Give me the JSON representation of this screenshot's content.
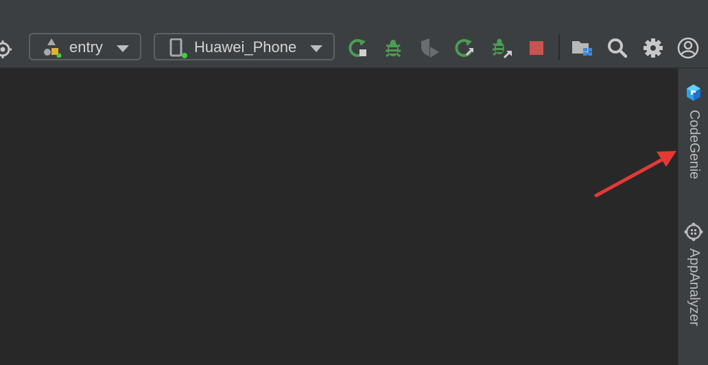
{
  "toolbar": {
    "module_selector": {
      "label": "entry"
    },
    "device_selector": {
      "label": "Huawei_Phone"
    },
    "icons": [
      "target-settings-icon",
      "module-icon",
      "phone-icon",
      "run-icon",
      "debug-icon",
      "profile-icon",
      "apply-changes-icon",
      "attach-debugger-icon",
      "stop-icon",
      "project-structure-icon",
      "search-icon",
      "gear-icon",
      "account-icon"
    ]
  },
  "right_panel": {
    "tabs": [
      {
        "label": "CodeGenie",
        "icon": "codegenie-icon"
      },
      {
        "label": "AppAnalyzer",
        "icon": "appanalyzer-icon"
      }
    ]
  },
  "annotation": {
    "arrow_color": "#e53935",
    "points_to": "CodeGenie"
  },
  "colors": {
    "toolbar_bg": "#3c3f41",
    "editor_bg": "#282828",
    "run_green": "#4a9e4f",
    "stop_red": "#c75450"
  }
}
